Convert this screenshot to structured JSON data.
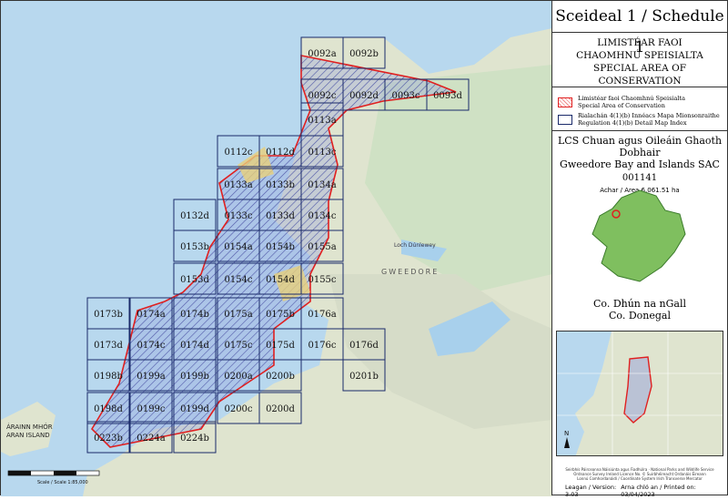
{
  "map": {
    "grid_labels": [
      "0092a",
      "0092b",
      "0092c",
      "0092d",
      "0093c",
      "0093d",
      "0113a",
      "0112c",
      "0112d",
      "0113c",
      "0133a",
      "0133b",
      "0134a",
      "0132d",
      "0133c",
      "0133d",
      "0134c",
      "0153b",
      "0154a",
      "0154b",
      "0155a",
      "0153d",
      "0154c",
      "0154d",
      "0155c",
      "0173b",
      "0174a",
      "0174b",
      "0175a",
      "0175b",
      "0176a",
      "0173d",
      "0174c",
      "0174d",
      "0175c",
      "0175d",
      "0176c",
      "0176d",
      "0198b",
      "0199a",
      "0199b",
      "0200a",
      "0200b",
      "0201b",
      "0198d",
      "0199c",
      "0199d",
      "0200c",
      "0200d",
      "0223b",
      "0224a",
      "0224b"
    ],
    "place_labels": {
      "aran": "ÁRAINN MHÓR",
      "aran_en": "ARAN ISLAND",
      "gweedore": "GWEEDORE",
      "loch": "Loch Dúnlewey"
    },
    "scale": "Scale / Scale 1:85,000"
  },
  "panel": {
    "title": "Sceideal 1 / Schedule 1",
    "zone_ga_1": "LIMISTÉAR FAOI",
    "zone_ga_2": "CHAOMHNÚ SPEISIALTA",
    "zone_en": "SPECIAL AREA OF CONSERVATION",
    "legend_sac_ga": "Limistéar faoi Chaomhnú Speisialta",
    "legend_sac_en": "Special Area of Conservation",
    "legend_grid_ga": "Rialachán 4(1)(b) Innéacs Mapa Mionsonraithe",
    "legend_grid_en": "Regulation 4(1)(b) Detail Map Index",
    "site_ga": "LCS Chuan agus Oileáin Ghaoth Dobhair",
    "site_en": "Gweedore Bay and Islands SAC",
    "site_code": "001141",
    "site_area": "Achar / Area 6,061.51 ha",
    "county_ga": "Co. Dhún na nGall",
    "county_en": "Co. Donegal",
    "footer_1": "Seirbhís Páirceanna Náisiúnta agus Fiadhúlra · National Parks and Wildlife Service",
    "footer_2": "Ordnance Survey Ireland Licence No. © Suirbhéireacht Ordanáis Éireann",
    "footer_3": "Lonnú Comhordanáidí / Coordinate System Irish Transverse Mercator",
    "version": "Leagan / Version: 3.03",
    "printed": "Arna chló an / Printed on: 03/04/2023"
  }
}
